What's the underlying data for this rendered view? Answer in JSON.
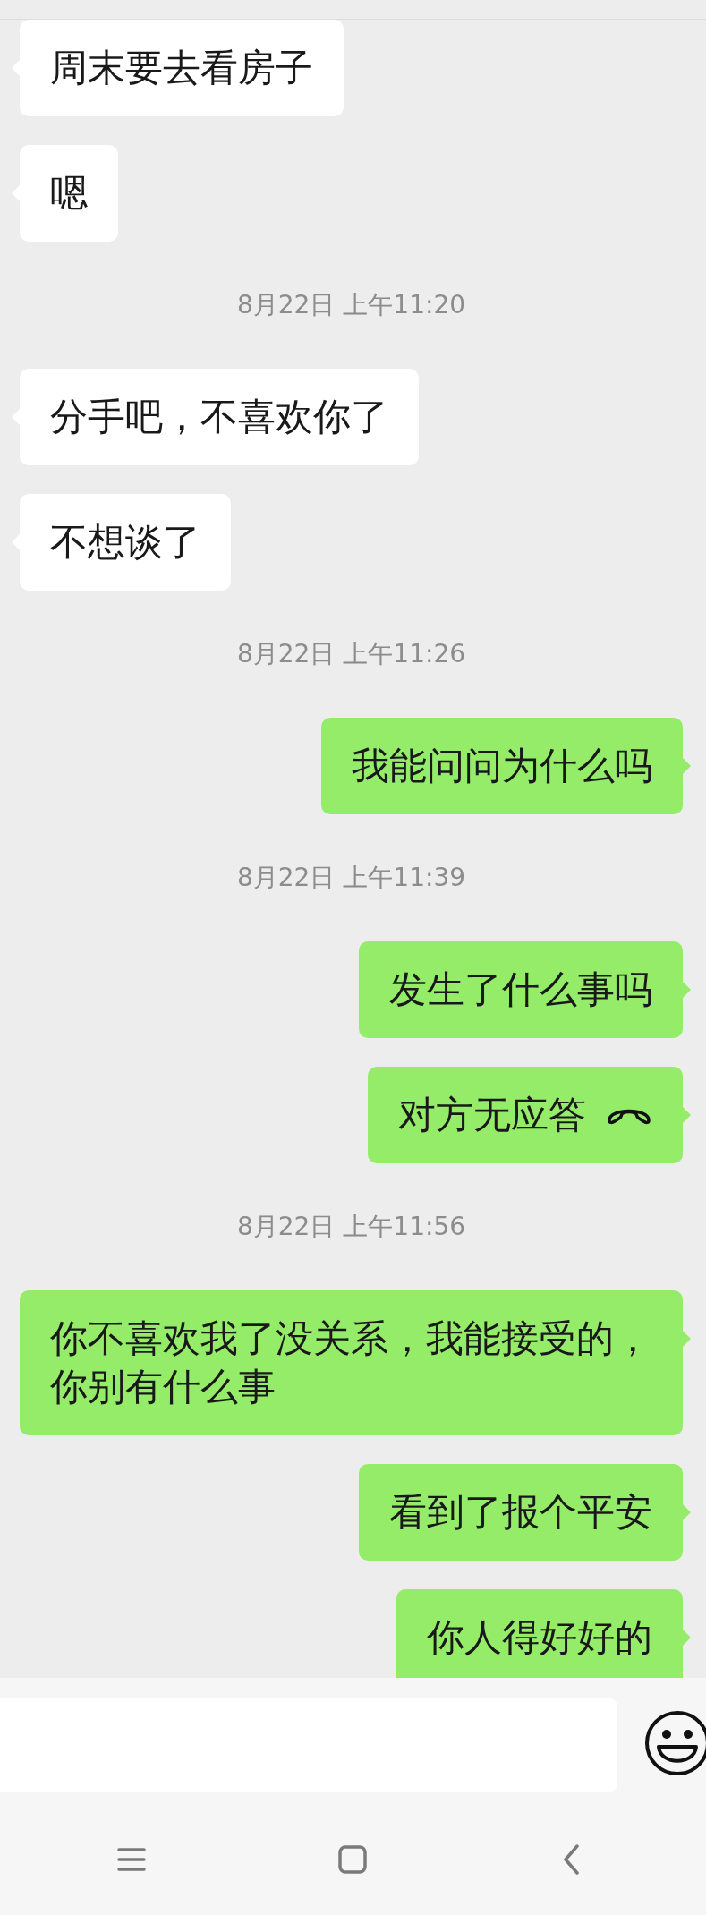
{
  "messages": [
    {
      "kind": "message",
      "from_me": false,
      "text": "周末要去看房子"
    },
    {
      "kind": "message",
      "from_me": false,
      "text": "嗯"
    },
    {
      "kind": "timestamp",
      "text": "8月22日 上午11:20"
    },
    {
      "kind": "message",
      "from_me": false,
      "text": "分手吧，不喜欢你了"
    },
    {
      "kind": "message",
      "from_me": false,
      "text": "不想谈了"
    },
    {
      "kind": "timestamp",
      "text": "8月22日 上午11:26"
    },
    {
      "kind": "message",
      "from_me": true,
      "text": "我能问问为什么吗"
    },
    {
      "kind": "timestamp",
      "text": "8月22日 上午11:39"
    },
    {
      "kind": "message",
      "from_me": true,
      "text": "发生了什么事吗"
    },
    {
      "kind": "call",
      "from_me": true,
      "text": "对方无应答"
    },
    {
      "kind": "timestamp",
      "text": "8月22日 上午11:56"
    },
    {
      "kind": "message",
      "from_me": true,
      "text": "你不喜欢我了没关系，我能接受的，你别有什么事"
    },
    {
      "kind": "message",
      "from_me": true,
      "text": "看到了报个平安"
    },
    {
      "kind": "message",
      "from_me": true,
      "text": "你人得好好的"
    }
  ]
}
